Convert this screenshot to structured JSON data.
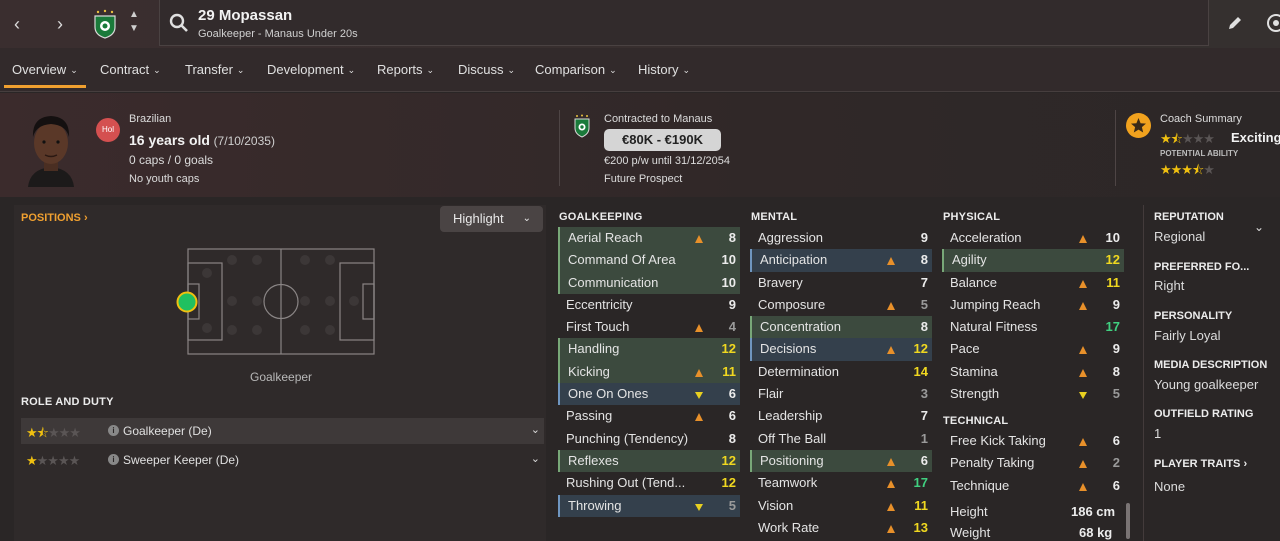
{
  "topbar": {
    "player_name": "29 Mopassan",
    "player_subtitle": "Goalkeeper - Manaus Under 20s"
  },
  "tabs": [
    {
      "label": "Overview"
    },
    {
      "label": "Contract"
    },
    {
      "label": "Transfer"
    },
    {
      "label": "Development"
    },
    {
      "label": "Reports"
    },
    {
      "label": "Discuss"
    },
    {
      "label": "Comparison"
    },
    {
      "label": "History"
    }
  ],
  "header": {
    "position_badge": "Hol",
    "nationality": "Brazilian",
    "age": "16 years old",
    "dob": "(7/10/2035)",
    "caps": "0 caps / 0 goals",
    "youth_caps": "No youth caps",
    "contract_club": "Contracted to Manaus",
    "value": "€80K - €190K",
    "wage": "€200 p/w until 31/12/2054",
    "prospect": "Future Prospect",
    "coach_title": "Coach Summary",
    "coach_rating_label": "Exciting",
    "current_ability_stars": 1.5,
    "potential_label": "POTENTIAL ABILITY",
    "potential_ability_stars": 3.5
  },
  "left": {
    "positions_link": "POSITIONS",
    "highlight_label": "Highlight",
    "position_label": "Goalkeeper",
    "role_title": "ROLE AND DUTY",
    "roles": [
      {
        "name": "Goalkeeper (De)",
        "stars": 1.5,
        "info": "i"
      },
      {
        "name": "Sweeper Keeper (De)",
        "stars": 1,
        "info": "i"
      }
    ]
  },
  "attributes": {
    "goalkeeping_title": "GOALKEEPING",
    "goalkeeping": [
      {
        "name": "Aerial Reach",
        "value": "8",
        "hl": "green",
        "arrow": "up",
        "color": "white"
      },
      {
        "name": "Command Of Area",
        "value": "10",
        "hl": "green",
        "arrow": "none",
        "color": "white"
      },
      {
        "name": "Communication",
        "value": "10",
        "hl": "green",
        "arrow": "none",
        "color": "white"
      },
      {
        "name": "Eccentricity",
        "value": "9",
        "hl": "",
        "arrow": "none",
        "color": "white"
      },
      {
        "name": "First Touch",
        "value": "4",
        "hl": "",
        "arrow": "up",
        "color": "gray"
      },
      {
        "name": "Handling",
        "value": "12",
        "hl": "green",
        "arrow": "none",
        "color": "yellow"
      },
      {
        "name": "Kicking",
        "value": "11",
        "hl": "green",
        "arrow": "up",
        "color": "yellow"
      },
      {
        "name": "One On Ones",
        "value": "6",
        "hl": "blue",
        "arrow": "down",
        "color": "white"
      },
      {
        "name": "Passing",
        "value": "6",
        "hl": "",
        "arrow": "up",
        "color": "white"
      },
      {
        "name": "Punching (Tendency)",
        "value": "8",
        "hl": "",
        "arrow": "none",
        "color": "white"
      },
      {
        "name": "Reflexes",
        "value": "12",
        "hl": "green",
        "arrow": "none",
        "color": "yellow"
      },
      {
        "name": "Rushing Out (Tend...",
        "value": "12",
        "hl": "",
        "arrow": "none",
        "color": "yellow"
      },
      {
        "name": "Throwing",
        "value": "5",
        "hl": "blue",
        "arrow": "down",
        "color": "gray"
      }
    ],
    "mental_title": "MENTAL",
    "mental": [
      {
        "name": "Aggression",
        "value": "9",
        "hl": "",
        "arrow": "none",
        "color": "white"
      },
      {
        "name": "Anticipation",
        "value": "8",
        "hl": "blue",
        "arrow": "up",
        "color": "white"
      },
      {
        "name": "Bravery",
        "value": "7",
        "hl": "",
        "arrow": "none",
        "color": "white"
      },
      {
        "name": "Composure",
        "value": "5",
        "hl": "",
        "arrow": "up",
        "color": "gray"
      },
      {
        "name": "Concentration",
        "value": "8",
        "hl": "green",
        "arrow": "none",
        "color": "white"
      },
      {
        "name": "Decisions",
        "value": "12",
        "hl": "blue",
        "arrow": "up",
        "color": "yellow"
      },
      {
        "name": "Determination",
        "value": "14",
        "hl": "",
        "arrow": "none",
        "color": "yellow"
      },
      {
        "name": "Flair",
        "value": "3",
        "hl": "",
        "arrow": "none",
        "color": "gray"
      },
      {
        "name": "Leadership",
        "value": "7",
        "hl": "",
        "arrow": "none",
        "color": "white"
      },
      {
        "name": "Off The Ball",
        "value": "1",
        "hl": "",
        "arrow": "none",
        "color": "gray"
      },
      {
        "name": "Positioning",
        "value": "6",
        "hl": "green",
        "arrow": "up",
        "color": "white"
      },
      {
        "name": "Teamwork",
        "value": "17",
        "hl": "",
        "arrow": "up",
        "color": "green"
      },
      {
        "name": "Vision",
        "value": "11",
        "hl": "",
        "arrow": "up",
        "color": "yellow"
      },
      {
        "name": "Work Rate",
        "value": "13",
        "hl": "",
        "arrow": "up",
        "color": "yellow"
      }
    ],
    "physical_title": "PHYSICAL",
    "physical": [
      {
        "name": "Acceleration",
        "value": "10",
        "hl": "",
        "arrow": "up",
        "color": "white"
      },
      {
        "name": "Agility",
        "value": "12",
        "hl": "green",
        "arrow": "none",
        "color": "yellow"
      },
      {
        "name": "Balance",
        "value": "11",
        "hl": "",
        "arrow": "up",
        "color": "yellow"
      },
      {
        "name": "Jumping Reach",
        "value": "9",
        "hl": "",
        "arrow": "up",
        "color": "white"
      },
      {
        "name": "Natural Fitness",
        "value": "17",
        "hl": "",
        "arrow": "none",
        "color": "green"
      },
      {
        "name": "Pace",
        "value": "9",
        "hl": "",
        "arrow": "up",
        "color": "white"
      },
      {
        "name": "Stamina",
        "value": "8",
        "hl": "",
        "arrow": "up",
        "color": "white"
      },
      {
        "name": "Strength",
        "value": "5",
        "hl": "",
        "arrow": "down",
        "color": "gray"
      }
    ],
    "technical_title": "TECHNICAL",
    "technical": [
      {
        "name": "Free Kick Taking",
        "value": "6",
        "hl": "",
        "arrow": "up",
        "color": "white"
      },
      {
        "name": "Penalty Taking",
        "value": "2",
        "hl": "",
        "arrow": "up",
        "color": "gray"
      },
      {
        "name": "Technique",
        "value": "6",
        "hl": "",
        "arrow": "up",
        "color": "white"
      }
    ],
    "height_label": "Height",
    "height_value": "186 cm",
    "weight_label": "Weight",
    "weight_value": "68 kg"
  },
  "right": {
    "reputation_title": "REPUTATION",
    "reputation_value": "Regional",
    "pref_foot_title": "PREFERRED FO...",
    "pref_foot_value": "Right",
    "personality_title": "PERSONALITY",
    "personality_value": "Fairly Loyal",
    "media_title": "MEDIA DESCRIPTION",
    "media_value": "Young goalkeeper",
    "outfield_title": "OUTFIELD RATING",
    "outfield_value": "1",
    "traits_title": "PLAYER TRAITS",
    "traits_value": "None"
  },
  "colors": {
    "accent": "#f0a030",
    "highlight_green": "#3c4a3e",
    "highlight_blue": "#34404c",
    "value_yellow": "#f0d820",
    "value_green": "#40d080"
  }
}
